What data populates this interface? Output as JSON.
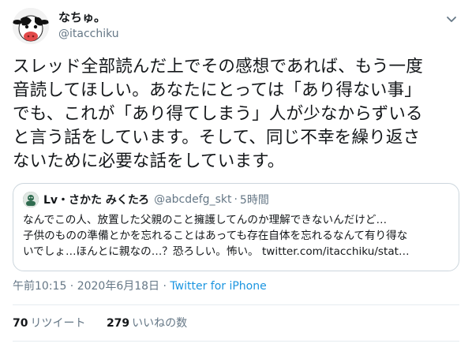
{
  "author": {
    "display_name": "なちゅ。",
    "handle": "@itacchiku",
    "avatar_icon": "cow-avatar-icon"
  },
  "more_icon": "chevron-down-icon",
  "tweet": {
    "lines": [
      "スレッド全部読んだ上でその感想であれば、もう一度",
      "音読してほしい。あなたにとっては「あり得ない事」",
      "でも、これが「あり得てしまう」人が少なからずいる",
      "と言う話をしています。そして、同じ不幸を繰り返さ",
      "ないために必要な話をしています。"
    ]
  },
  "quote": {
    "name": "Lv・さかた みくたろ",
    "handle": "@abcdefg_skt",
    "separator": "·",
    "time": "5時間",
    "lines": [
      "なんでこの人、放置した父親のこと擁護してんのか理解できないんだけど…",
      "子供のものの準備とかを忘れることはあっても存在自体を忘れるなんて有り得な",
      "いでしょ…ほんとに親なの…？恐ろしい。怖い。 twitter.com/itacchiku/stat…"
    ]
  },
  "timestamp": {
    "text": "午前10:15 · 2020年6月18日 · ",
    "via": "Twitter for iPhone"
  },
  "stats": {
    "retweets_count": "70",
    "retweets_label": "リツイート",
    "likes_count": "279",
    "likes_label": "いいねの数"
  },
  "colors": {
    "link": "#1b95e0",
    "muted": "#657786",
    "border": "#ccd6dd"
  }
}
